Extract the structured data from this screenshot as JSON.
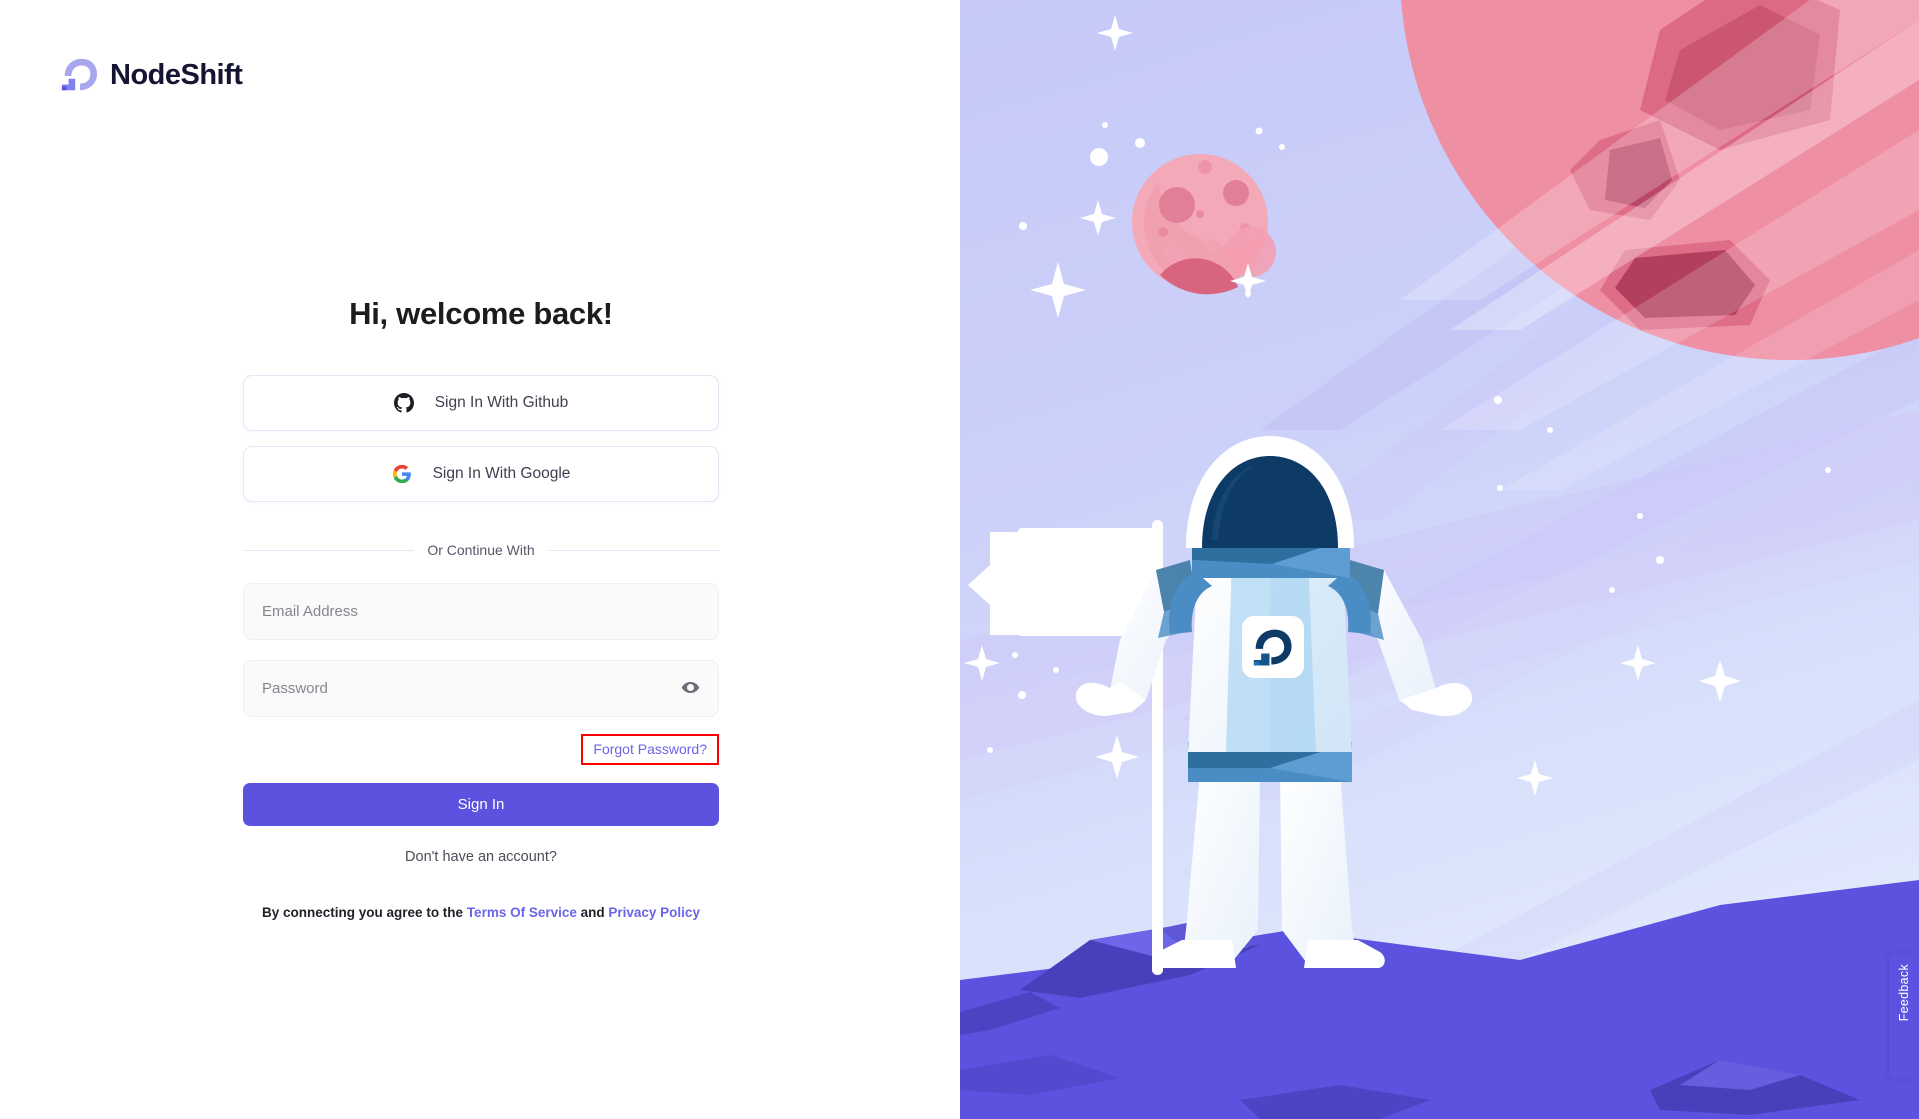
{
  "brand": {
    "name": "NodeShift",
    "logo_icon": "nodeshift-wave-logo",
    "colors": {
      "logo_light": "#a9a6f0",
      "logo_mid": "#7d84ef",
      "logo_dark": "#5b52e0",
      "wordmark": "#151433"
    }
  },
  "auth": {
    "headline": "Hi, welcome back!",
    "oauth": [
      {
        "label": "Sign In With Github",
        "icon": "github-icon",
        "provider": "github"
      },
      {
        "label": "Sign In With Google",
        "icon": "google-icon",
        "provider": "google"
      }
    ],
    "divider_text": "Or Continue With",
    "fields": [
      {
        "name": "email",
        "placeholder": "Email Address",
        "value": "",
        "type": "email"
      },
      {
        "name": "password",
        "placeholder": "Password",
        "value": "",
        "type": "password",
        "toggle_icon": "eye-icon"
      }
    ],
    "forgot_password": "Forgot Password?",
    "submit_label": "Sign In",
    "signup_prompt": "Don't have an account?",
    "terms": {
      "prefix": "By connecting you agree to the ",
      "terms_link": "Terms Of Service",
      "conjunction": " and ",
      "privacy_link": "Privacy Policy"
    }
  },
  "highlight": {
    "target": "forgot-password-link",
    "color": "#ff0000"
  },
  "feedback": {
    "label": "Feedback",
    "icon": "chat-bubble-icon"
  },
  "illustration": {
    "alt": "Astronaut standing on purple planet surface holding a flag, with pink planets and stars in a lavender space background",
    "colors": {
      "sky_top": "#c7caf7",
      "sky_bottom": "#dfe6fb",
      "terrain": "#5b52e0",
      "terrain_dark": "#4840bb",
      "planet_small": "#f4a9b8",
      "planet_large": "#ef8fa3",
      "suit_white": "#ffffff",
      "visor_dark": "#0d3b66",
      "accent_blue": "#4f8fc4"
    }
  },
  "theme": {
    "accent": "#5b52e0",
    "link": "#6c63e8",
    "text": "#1c1c1c",
    "muted": "#84868f"
  }
}
